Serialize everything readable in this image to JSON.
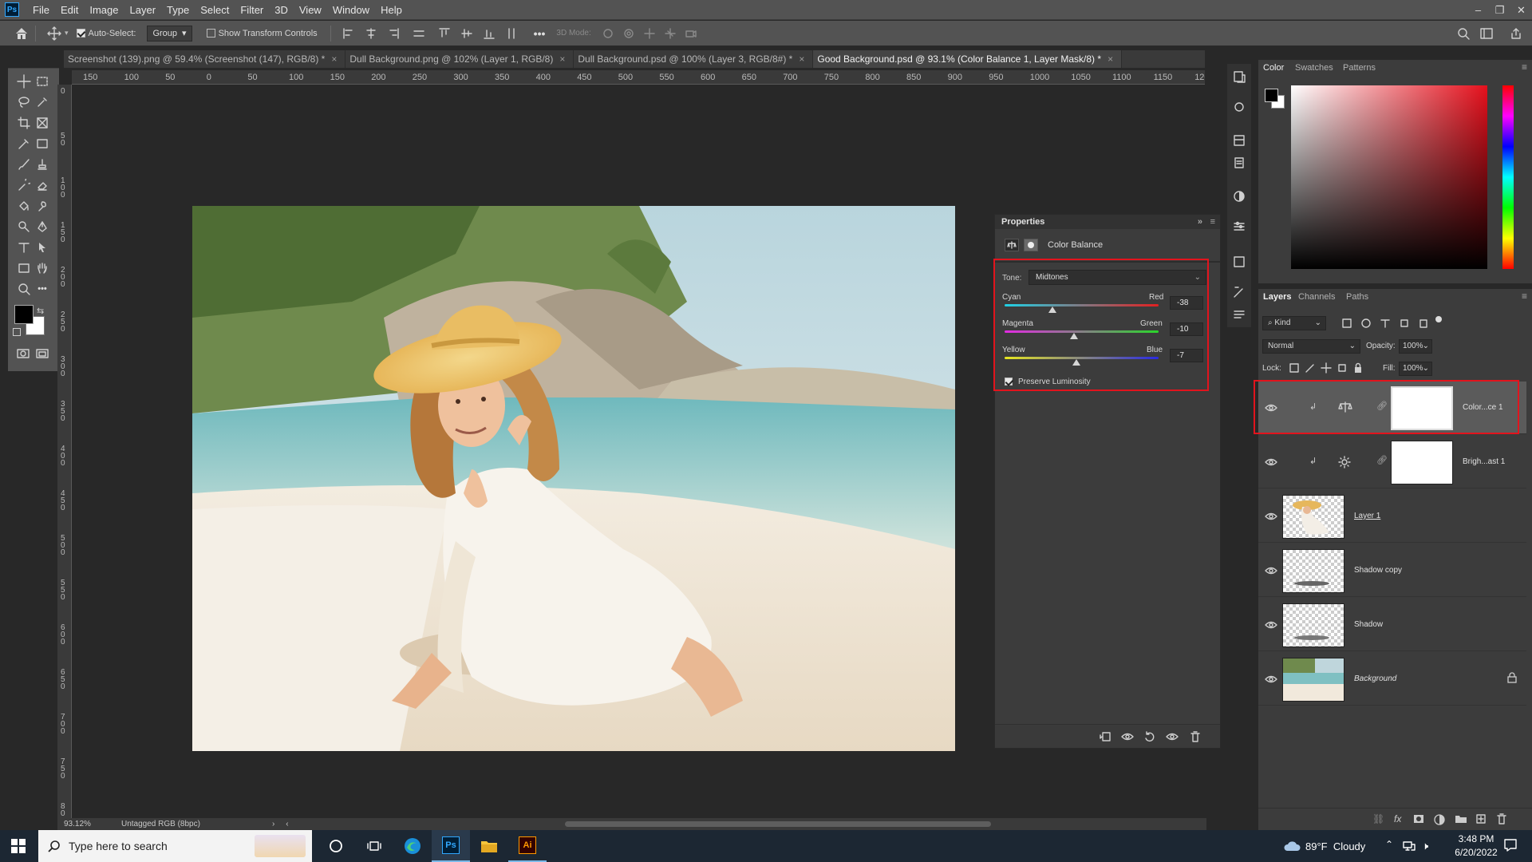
{
  "app": {
    "logo": "Ps"
  },
  "menu": [
    "File",
    "Edit",
    "Image",
    "Layer",
    "Type",
    "Select",
    "Filter",
    "3D",
    "View",
    "Window",
    "Help"
  ],
  "window_controls": [
    "–",
    "❐",
    "✕"
  ],
  "options": {
    "auto_select_label": "Auto-Select:",
    "auto_select_value": "Group",
    "transform_label": "Show Transform Controls",
    "mode_3d": "3D Mode:"
  },
  "tabs": [
    {
      "label": "Screenshot (139).png @ 59.4% (Screenshot (147), RGB/8) *"
    },
    {
      "label": "Dull Background.png @ 102% (Layer 1, RGB/8)"
    },
    {
      "label": "Dull Background.psd @ 100% (Layer 3, RGB/8#) *"
    },
    {
      "label": "Good Background.psd @ 93.1% (Color Balance 1, Layer Mask/8) *"
    }
  ],
  "ruler_h": [
    "150",
    "100",
    "50",
    "0",
    "50",
    "100",
    "150",
    "200",
    "250",
    "300",
    "350",
    "400",
    "450",
    "500",
    "550",
    "600",
    "650",
    "700",
    "750",
    "800",
    "850",
    "900",
    "950",
    "1000",
    "1050",
    "1100",
    "1150",
    "1200",
    "12"
  ],
  "ruler_v": [
    "0",
    "5 0",
    "1 0 0",
    "1 5 0",
    "2 0 0",
    "2 5 0",
    "3 0 0",
    "3 5 0",
    "4 0 0",
    "4 5 0",
    "5 0 0",
    "5 5 0",
    "6 0 0",
    "6 5 0",
    "7 0 0",
    "7 5 0",
    "8 0"
  ],
  "status": {
    "zoom": "93.12%",
    "profile": "Untagged RGB (8bpc)"
  },
  "properties": {
    "title": "Properties",
    "adjustment": "Color Balance",
    "tone_label": "Tone:",
    "tone_value": "Midtones",
    "sliders": [
      {
        "left": "Cyan",
        "right": "Red",
        "value": "-38",
        "fraction": 0.31
      },
      {
        "left": "Magenta",
        "right": "Green",
        "value": "-10",
        "fraction": 0.45
      },
      {
        "left": "Yellow",
        "right": "Blue",
        "value": "-7",
        "fraction": 0.465
      }
    ],
    "preserve_luminosity": "Preserve Luminosity"
  },
  "color_panel": {
    "tabs": [
      "Color",
      "Swatches",
      "Patterns"
    ]
  },
  "layers_panel": {
    "tabs": [
      "Layers",
      "Channels",
      "Paths"
    ],
    "kind": "Kind",
    "blend_mode": "Normal",
    "opacity_label": "Opacity:",
    "opacity": "100%",
    "lock_label": "Lock:",
    "fill_label": "Fill:",
    "fill": "100%",
    "layers": [
      {
        "name": "Color...ce 1"
      },
      {
        "name": "Brigh...ast 1"
      },
      {
        "name": "Layer 1"
      },
      {
        "name": "Shadow copy"
      },
      {
        "name": "Shadow"
      },
      {
        "name": "Background"
      }
    ]
  },
  "taskbar": {
    "search_placeholder": "Type here to search",
    "weather": "89°F  Cloudy",
    "time": "3:48 PM",
    "date": "6/20/2022",
    "ai_label": "Ai",
    "ps_label": "Ps"
  },
  "colors": {
    "accent_red": "#e2141d",
    "ps_blue": "#31a8ff"
  }
}
